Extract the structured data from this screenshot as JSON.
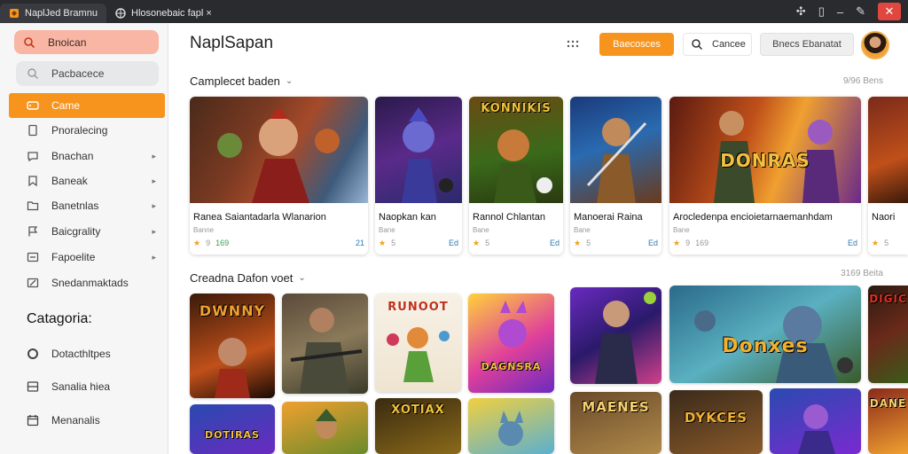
{
  "browser": {
    "tabs": [
      {
        "label": "NaplЈed Bramnu"
      },
      {
        "label": "Hlosonebaic fapl ×"
      }
    ]
  },
  "sidebar": {
    "search_label": "Bnoican",
    "search2_label": "Pacbacece",
    "items": [
      {
        "label": "Came",
        "active": true
      },
      {
        "label": "Pnoralecing"
      },
      {
        "label": "Bnachan"
      },
      {
        "label": "Baneak"
      },
      {
        "label": "Banetnlas"
      },
      {
        "label": "Baicgrality"
      },
      {
        "label": "Fapoelite"
      },
      {
        "label": "Snedanmaktads"
      }
    ],
    "categories_heading": "Catagoria:",
    "categories": [
      {
        "label": "Dotacthltpes"
      },
      {
        "label": "Sanalia hiea"
      },
      {
        "label": "Menanalis"
      }
    ]
  },
  "header": {
    "title": "NaplSapan",
    "primary_button": "Baecosces",
    "search_label": "Cancee",
    "secondary_button": "Bnecs Ebanatat"
  },
  "sections": [
    {
      "title": "Camplecet baden",
      "more": "9/96 Bens",
      "cards": [
        {
          "title": "Ranea Saiantadarla Wlanarion",
          "sub": "Banne",
          "rating": "9",
          "badge": "169",
          "right": "21"
        },
        {
          "title": "Naopkan kan",
          "sub": "Bane",
          "rating": "5",
          "badge": "",
          "right": "Ed"
        },
        {
          "title": "Rannol Chlantan",
          "sub": "Bane",
          "rating": "5",
          "badge": "",
          "right": "Ed"
        },
        {
          "title": "Manoerai Raina",
          "sub": "Bane",
          "rating": "5",
          "badge": "",
          "right": "Ed"
        },
        {
          "title": "Arocledenpa encioietarnaemanhdam",
          "sub": "Bane",
          "rating": "9",
          "badge": "169",
          "right": "Ed"
        },
        {
          "title": "Naori",
          "sub": "",
          "rating": "5",
          "badge": "",
          "right": ""
        }
      ],
      "art_texts": [
        "",
        "",
        "KONNIKIS",
        "",
        "DONRAS",
        ""
      ]
    },
    {
      "title": "Creadna Dafon voet",
      "more": "3169 Beita",
      "tile_texts": [
        "DWNNY",
        "",
        "RUNOOT",
        "DAGNSRA",
        "",
        "Donxes",
        "DIGIC",
        "DOTIRAS",
        "",
        "XOTIAX",
        "",
        "MAENES",
        "DYKCES",
        "",
        "DANE"
      ]
    }
  ],
  "colors": {
    "accent": "#f7941d",
    "search_pill": "#f9b6a4",
    "titlebar": "#2a2b2f",
    "close": "#e0473f"
  }
}
